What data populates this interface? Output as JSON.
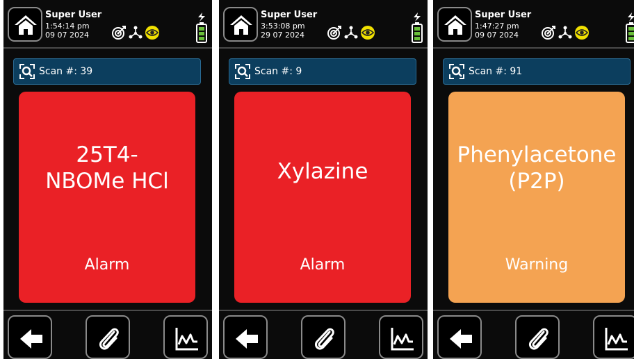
{
  "colors": {
    "alarm": "#ea2126",
    "warning": "#f4a352",
    "scan_bar": "#0c3e5e",
    "screen_bg": "#0b0b0b",
    "status_yellow": "#f0e000"
  },
  "icons": [
    "home-icon",
    "target-icon",
    "molecule-icon",
    "eye-icon",
    "battery-icon",
    "charging-bolt-icon",
    "scan-icon",
    "back-arrow-icon",
    "paperclip-icon",
    "chart-icon"
  ],
  "screens": [
    {
      "user": {
        "name": "Super User",
        "time": "1:54:14 pm",
        "date": "09 07 2024"
      },
      "scan": {
        "label": "Scan #: 39"
      },
      "result": {
        "line1": "25T4-",
        "line2": "NBOMe HCl",
        "level": "Alarm"
      }
    },
    {
      "user": {
        "name": "Super User",
        "time": "3:53:08 pm",
        "date": "29 07 2024"
      },
      "scan": {
        "label": "Scan #: 9"
      },
      "result": {
        "line1": "Xylazine",
        "level": "Alarm"
      }
    },
    {
      "user": {
        "name": "Super User",
        "time": "1:47:27 pm",
        "date": "09 07 2024"
      },
      "scan": {
        "label": "Scan #: 91"
      },
      "result": {
        "line1": "Phenylacetone",
        "line2": "(P2P)",
        "level": "Warning"
      }
    }
  ]
}
